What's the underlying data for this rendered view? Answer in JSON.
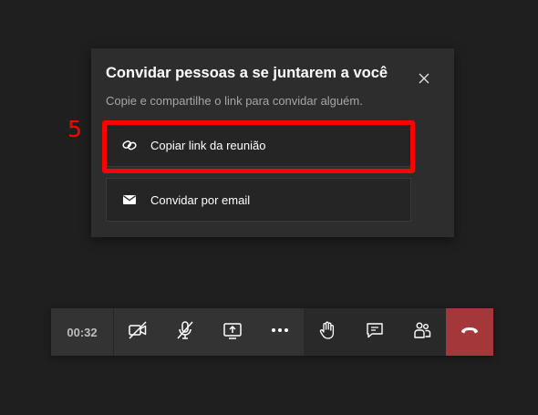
{
  "dialog": {
    "title": "Convidar pessoas a se juntarem a você",
    "subtitle": "Copie e compartilhe o link para convidar alguém.",
    "close_icon": "close-icon",
    "options": [
      {
        "label": "Copiar link da reunião",
        "icon": "link-icon"
      },
      {
        "label": "Convidar por email",
        "icon": "envelope-icon"
      }
    ]
  },
  "annotation": {
    "step_number": "5",
    "color": "#ff0000"
  },
  "toolbar": {
    "timer": "00:32",
    "buttons": [
      "camera-off-icon",
      "mic-off-icon",
      "share-screen-icon",
      "more-options-icon",
      "raise-hand-icon",
      "chat-icon",
      "participants-icon",
      "hang-up-icon"
    ],
    "hangup_color": "#a4373a"
  },
  "colors": {
    "background": "#1f1f1f",
    "dialog_bg": "#2d2d2d",
    "option_bg": "#252525"
  }
}
